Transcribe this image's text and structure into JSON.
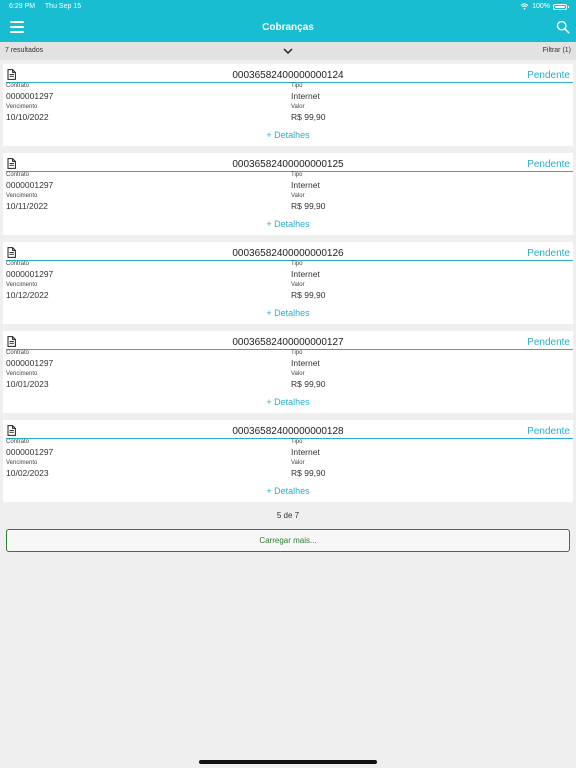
{
  "status_bar": {
    "time": "6:29 PM",
    "date": "Thu Sep 15",
    "battery": "100%"
  },
  "header": {
    "title": "Cobranças"
  },
  "toolbar": {
    "results": "7 resultados",
    "filter": "Filtrar (1)"
  },
  "labels": {
    "contract": "Contrato",
    "type": "Tipo",
    "due": "Vencimento",
    "value": "Valor",
    "details": "+ Detalhes"
  },
  "cards": [
    {
      "number": "00036582400000000124",
      "status": "Pendente",
      "contract": "0000001297",
      "type": "Internet",
      "due": "10/10/2022",
      "value": "R$ 99,90"
    },
    {
      "number": "00036582400000000125",
      "status": "Pendente",
      "contract": "0000001297",
      "type": "Internet",
      "due": "10/11/2022",
      "value": "R$ 99,90"
    },
    {
      "number": "00036582400000000126",
      "status": "Pendente",
      "contract": "0000001297",
      "type": "Internet",
      "due": "10/12/2022",
      "value": "R$ 99,90"
    },
    {
      "number": "00036582400000000127",
      "status": "Pendente",
      "contract": "0000001297",
      "type": "Internet",
      "due": "10/01/2023",
      "value": "R$ 99,90"
    },
    {
      "number": "00036582400000000128",
      "status": "Pendente",
      "contract": "0000001297",
      "type": "Internet",
      "due": "10/02/2023",
      "value": "R$ 99,90"
    }
  ],
  "pager": "5 de 7",
  "load_more": "Carregar mais...",
  "colors": {
    "header": "#18bdd1",
    "accent": "#2aaec5",
    "load_more": "#2e7d32"
  }
}
